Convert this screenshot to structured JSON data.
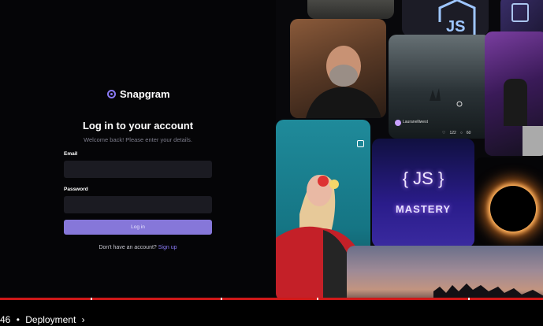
{
  "brand": {
    "name": "Snapgram"
  },
  "login": {
    "title": "Log in to your account",
    "subtitle": "Welcome back! Please enter your details.",
    "email_label": "Email",
    "password_label": "Password",
    "login_button": "Log in",
    "signup_prompt": "Don't have an account?",
    "signup_link": "Sign up"
  },
  "gallery": {
    "username": "Lauranelliwest",
    "likes": "122",
    "comments": "60",
    "neon_js": "{ JS }",
    "neon_mastery": "MASTERY",
    "badge_label": "JS"
  },
  "video": {
    "time": "46",
    "separator": "•",
    "chapter": "Deployment",
    "chapter_icon": "chevron-right-icon"
  },
  "colors": {
    "accent": "#8677d9",
    "progress": "#d01818",
    "field": "#1b1b22"
  }
}
